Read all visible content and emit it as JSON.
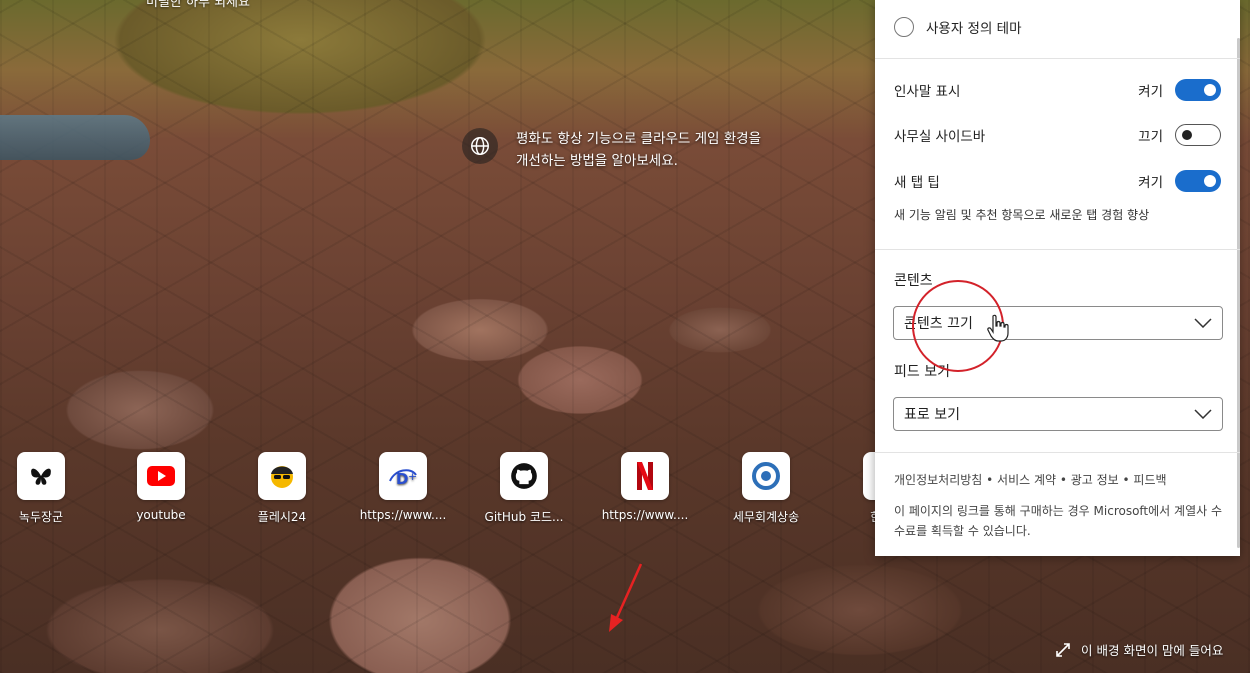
{
  "background": {
    "top_text": "미필한 하루 되세요",
    "tip_text": "평화도 항상 기능으로 클라우드 게임 환경을 개선하는 방법을 알아보세요.",
    "bg_info": "이 배경 화면이 맘에 들어요"
  },
  "quick_links": [
    {
      "label": "녹두장군",
      "icon": "butterfly-icon"
    },
    {
      "label": "youtube",
      "icon": "youtube-icon"
    },
    {
      "label": "플레시24",
      "icon": "avatar-sunglasses-icon"
    },
    {
      "label": "https://www....",
      "icon": "disney-plus-icon"
    },
    {
      "label": "GitHub 코드...",
      "icon": "github-icon"
    },
    {
      "label": "https://www....",
      "icon": "netflix-icon"
    },
    {
      "label": "세무회계상송",
      "icon": "tax-logo-icon"
    },
    {
      "label": "한컴...",
      "icon": "hancom-icon"
    }
  ],
  "panel": {
    "custom_theme_label": "사용자 정의 테마",
    "greeting": {
      "label": "인사말 표시",
      "state_label": "켜기",
      "on": true
    },
    "office_sidebar": {
      "label": "사무실 사이드바",
      "state_label": "끄기",
      "on": false
    },
    "new_tab_tips": {
      "label": "새 탭 팁",
      "state_label": "켜기",
      "on": true,
      "description": "새 기능 알림 및 추천 항목으로 새로운 탭 경험 향상"
    },
    "content_title": "콘텐츠",
    "content_select": "콘텐츠 끄기",
    "feed_title": "피드 보기",
    "feed_select": "표로 보기",
    "footer_links": "개인정보처리방침 • 서비스 계약 • 광고 정보 • 피드백",
    "footer_note": "이 페이지의 링크를 통해 구매하는 경우 Microsoft에서 계열사 수수료를 획득할 수 있습니다."
  },
  "colors": {
    "accent": "#1a6dcc",
    "annotation": "#d3222a"
  }
}
